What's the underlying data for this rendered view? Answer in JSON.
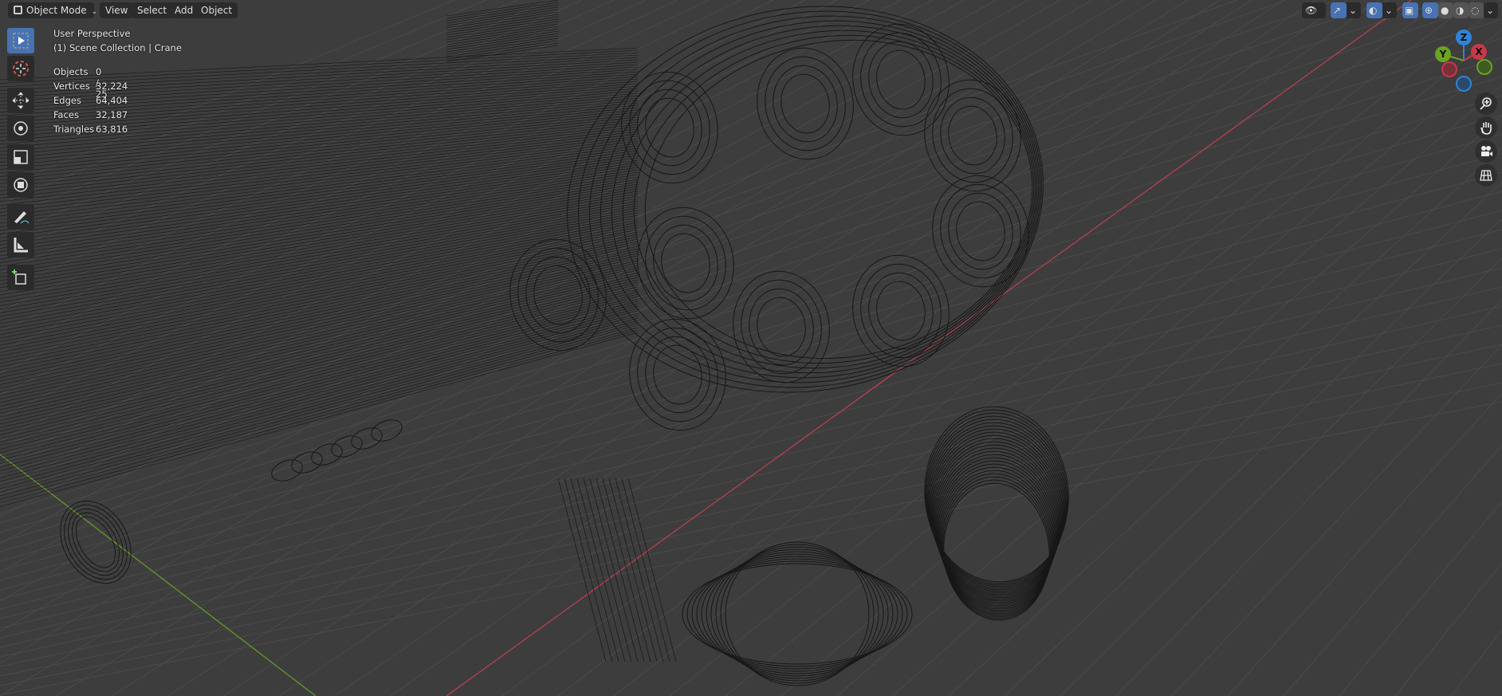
{
  "header": {
    "mode": "Object Mode",
    "menus": [
      "View",
      "Select",
      "Add",
      "Object"
    ]
  },
  "overlay_info": {
    "view": "User Perspective",
    "collection": "(1) Scene Collection | Crane"
  },
  "stats": [
    {
      "label": "Objects",
      "value": "0 / 25"
    },
    {
      "label": "Vertices",
      "value": "32,224"
    },
    {
      "label": "Edges",
      "value": "64,404"
    },
    {
      "label": "Faces",
      "value": "32,187"
    },
    {
      "label": "Triangles",
      "value": "63,816"
    }
  ],
  "gizmo": {
    "z": "Z",
    "y": "Y",
    "x": "X"
  },
  "colors": {
    "accent": "#4772b3",
    "x_axis": "#c8384a",
    "y_axis": "#6aa321",
    "z_axis": "#2f83d8",
    "viewport": "#3d3d3d"
  },
  "icons": {
    "tools": [
      "select-box",
      "cursor",
      "move",
      "rotate",
      "scale",
      "transform",
      "annotate",
      "measure",
      "add-cube"
    ],
    "nav": [
      "zoom",
      "pan",
      "camera",
      "ortho-grid"
    ]
  },
  "viewport_shading": "wireframe"
}
